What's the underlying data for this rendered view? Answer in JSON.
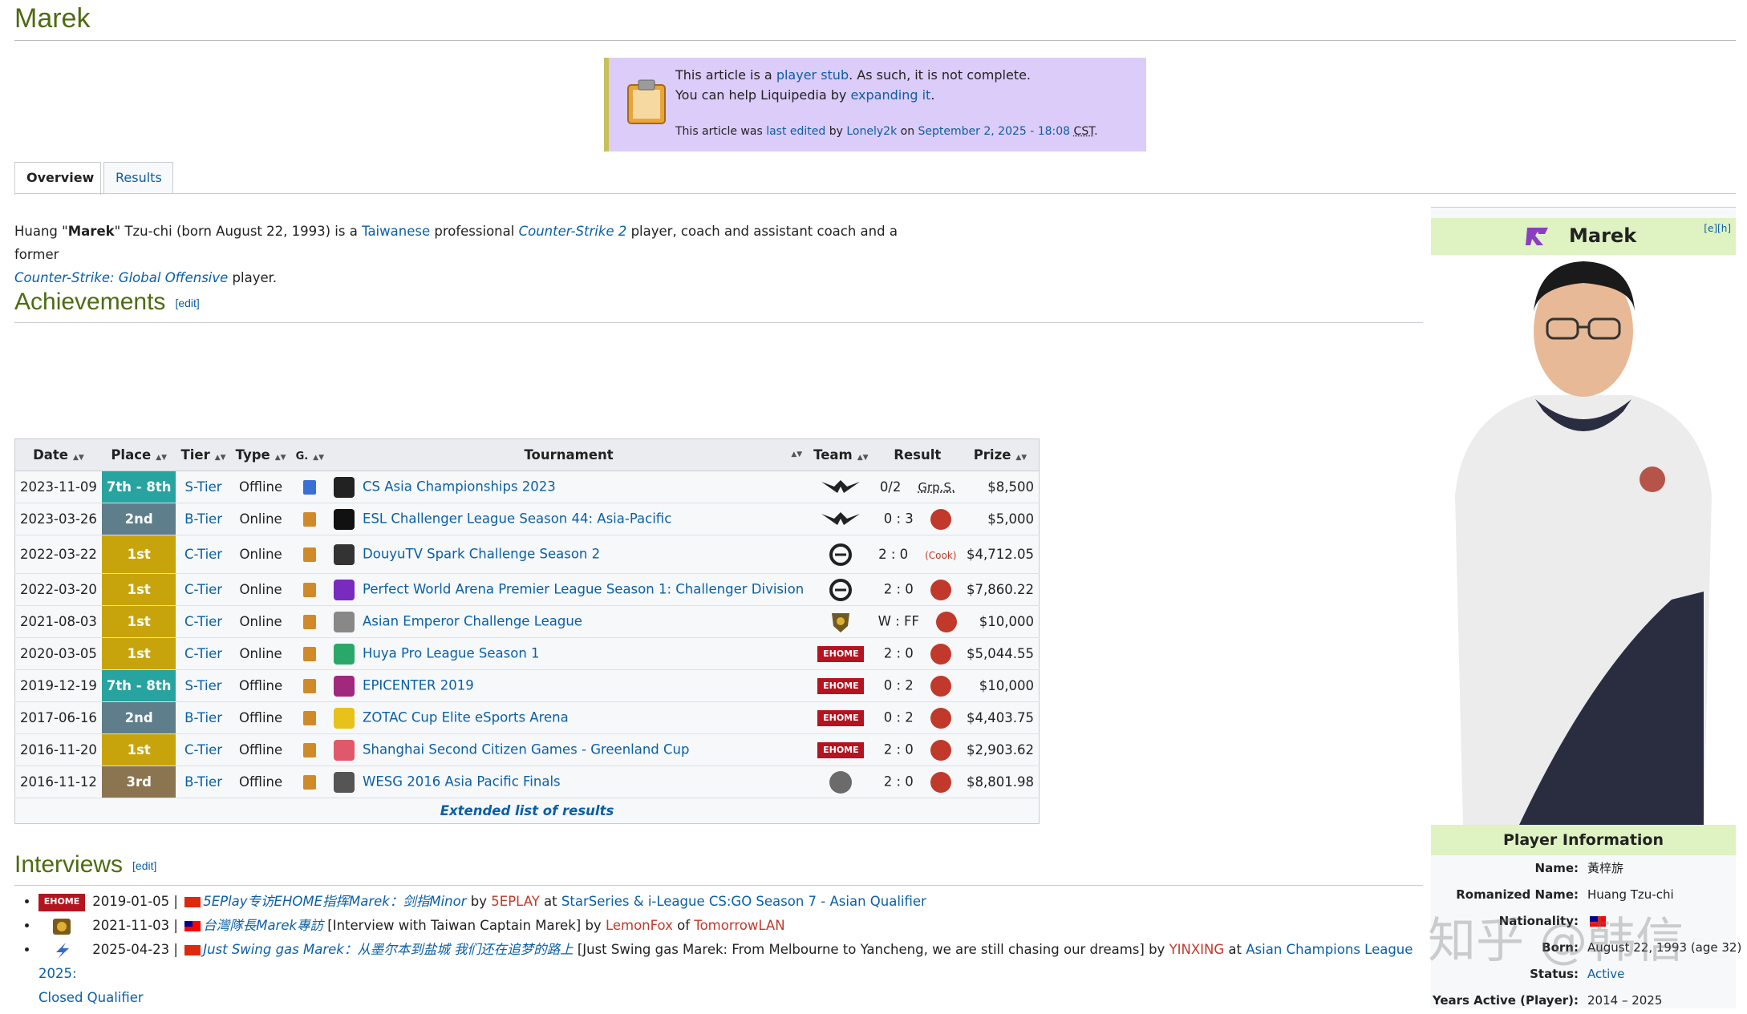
{
  "page": {
    "title": "Marek"
  },
  "stub": {
    "l1_pre": "This article is a ",
    "l1_link": "player stub",
    "l1_post": ". As such, it is not complete.",
    "l2_pre": "You can help Liquipedia by ",
    "l2_link": "expanding it",
    "l2_post": ".",
    "l3_pre": "This article was ",
    "l3_link1": "last edited",
    "l3_mid1": " by ",
    "l3_link2": "Lonely2k",
    "l3_mid2": " on ",
    "l3_link3": "September 2, 2025 - 18:08",
    "l3_cst": "CST",
    "l3_post": "."
  },
  "tabs": [
    "Overview",
    "Results"
  ],
  "intro": {
    "p1": "Huang \"",
    "bold": "Marek",
    "p2": "\" Tzu-chi (born August 22, 1993) is a ",
    "link1": "Taiwanese",
    "p3": " professional ",
    "link2": "Counter-Strike 2",
    "p4": " player, coach and assistant coach and a former",
    "link3": "Counter-Strike: Global Offensive",
    "p5": " player."
  },
  "achievements": {
    "heading": "Achievements",
    "edit": "[edit]"
  },
  "interviews_section": {
    "heading": "Interviews",
    "edit": "[edit]"
  },
  "results_table": {
    "headers": [
      "Date",
      "Place",
      "Tier",
      "Type",
      "G.",
      "Tournament",
      "Team",
      "Result",
      "Prize"
    ],
    "rows": [
      {
        "date": "2023-11-09",
        "place": "7th - 8th",
        "place_class": "p-top8",
        "tier": "S-Tier",
        "type": "Offline",
        "game": "cs2",
        "tournament": "CS Asia Championships 2023",
        "result": "0/2",
        "opp_text": "Grp.S.",
        "prize": "$8,500"
      },
      {
        "date": "2023-03-26",
        "place": "2nd",
        "place_class": "p-silver",
        "tier": "B-Tier",
        "type": "Online",
        "game": "csgo",
        "tournament": "ESL Challenger League Season 44: Asia-Pacific",
        "result": "0 : 3",
        "opp_text": "",
        "prize": "$5,000"
      },
      {
        "date": "2022-03-22",
        "place": "1st",
        "place_class": "p-gold",
        "tier": "C-Tier",
        "type": "Online",
        "game": "csgo",
        "tournament": "DouyuTV Spark Challenge Season 2",
        "result": "2 : 0",
        "opp_text": "(Cook)",
        "prize": "$4,712.05"
      },
      {
        "date": "2022-03-20",
        "place": "1st",
        "place_class": "p-gold",
        "tier": "C-Tier",
        "type": "Online",
        "game": "csgo",
        "tournament": "Perfect World Arena Premier League Season 1: Challenger Division",
        "result": "2 : 0",
        "opp_text": "",
        "prize": "$7,860.22"
      },
      {
        "date": "2021-08-03",
        "place": "1st",
        "place_class": "p-gold",
        "tier": "C-Tier",
        "type": "Online",
        "game": "csgo",
        "tournament": "Asian Emperor Challenge League",
        "result": "W : FF",
        "opp_text": "",
        "prize": "$10,000"
      },
      {
        "date": "2020-03-05",
        "place": "1st",
        "place_class": "p-gold",
        "tier": "C-Tier",
        "type": "Online",
        "game": "csgo",
        "tournament": "Huya Pro League Season 1",
        "result": "2 : 0",
        "opp_text": "",
        "prize": "$5,044.55"
      },
      {
        "date": "2019-12-19",
        "place": "7th - 8th",
        "place_class": "p-top8",
        "tier": "S-Tier",
        "type": "Offline",
        "game": "csgo",
        "tournament": "EPICENTER 2019",
        "result": "0 : 2",
        "opp_text": "",
        "prize": "$10,000"
      },
      {
        "date": "2017-06-16",
        "place": "2nd",
        "place_class": "p-silver",
        "tier": "B-Tier",
        "type": "Offline",
        "game": "csgo",
        "tournament": "ZOTAC Cup Elite eSports Arena",
        "result": "0 : 2",
        "opp_text": "",
        "prize": "$4,403.75"
      },
      {
        "date": "2016-11-20",
        "place": "1st",
        "place_class": "p-gold",
        "tier": "C-Tier",
        "type": "Offline",
        "game": "csgo",
        "tournament": "Shanghai Second Citizen Games - Greenland Cup",
        "result": "2 : 0",
        "opp_text": "",
        "prize": "$2,903.62"
      },
      {
        "date": "2016-11-12",
        "place": "3rd",
        "place_class": "p-bronze",
        "tier": "B-Tier",
        "type": "Offline",
        "game": "csgo",
        "tournament": "WESG 2016 Asia Pacific Finals",
        "result": "2 : 0",
        "opp_text": "",
        "prize": "$8,801.98"
      }
    ],
    "team_badge_text": "EHOME",
    "extended_link": "Extended list of results"
  },
  "interviews": [
    {
      "logo": "EHOME",
      "date": "2019-01-05",
      "sep": "|",
      "title": "5EPlay专访EHOME指挥Marek：剑指Minor",
      "by": "by",
      "author": "5EPLAY",
      "at": "at",
      "event": "StarSeries & i-League CS:GO Season 7 - Asian Qualifier",
      "translation": ""
    },
    {
      "logo": "",
      "date": "2021-11-03",
      "sep": "|",
      "title": "台灣隊長Marek專訪",
      "translation": "[Interview with Taiwan Captain Marek]",
      "by": "by",
      "author": "LemonFox",
      "at": "of",
      "event": "TomorrowLAN"
    },
    {
      "logo": "",
      "date": "2025-04-23",
      "sep": "|",
      "title": "Just Swing gas Marek：从墨尔本到盐城 我们还在追梦的路上",
      "translation": "[Just Swing gas Marek: From Melbourne to Yancheng, we are still chasing our dreams]",
      "by": "by",
      "author": "YINXING",
      "at": "at",
      "event": "Asian Champions League 2025:",
      "event2": "Closed Qualifier"
    }
  ],
  "infobox": {
    "name": "Marek",
    "edit_links": "[e][h]",
    "section": "Player Information",
    "rows": [
      {
        "k": "Name:",
        "v": "黃梓旂"
      },
      {
        "k": "Romanized Name:",
        "v": "Huang Tzu-chi"
      },
      {
        "k": "Nationality:",
        "v": ""
      },
      {
        "k": "Born:",
        "v": "August 22, 1993 (age 32)"
      },
      {
        "k": "Status:",
        "v": "Active"
      },
      {
        "k": "Years Active (Player):",
        "v": "2014 – 2025"
      }
    ]
  },
  "watermark": "知乎 @韩信",
  "colors": {
    "accent_green": "#4e6b12",
    "link": "#0b5fa5",
    "stub_bg": "#dcccf9",
    "infobox_head": "#dff2c2",
    "gold": "#c8a40c",
    "silver": "#5e7e8b",
    "bronze": "#8a7550",
    "top8": "#27a3a0"
  }
}
